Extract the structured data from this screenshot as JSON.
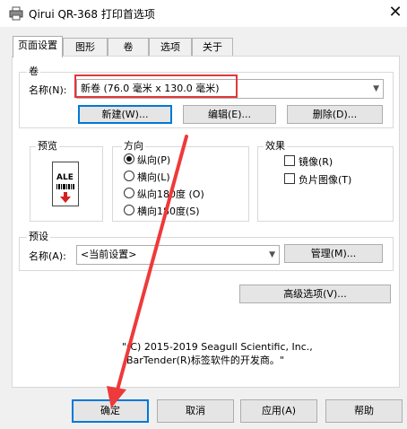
{
  "window": {
    "title": "Qirui QR-368 打印首选项",
    "close": "✕"
  },
  "tabs": [
    "页面设置",
    "图形",
    "卷",
    "选项",
    "关于"
  ],
  "roll": {
    "group_title": "卷",
    "name_label": "名称(N):",
    "name_value": "新卷 (76.0 毫米 x 130.0 毫米)",
    "buttons": [
      "新建(W)...",
      "编辑(E)...",
      "删除(D)..."
    ]
  },
  "preview": {
    "title": "预览",
    "sample": "ALE"
  },
  "orientation": {
    "title": "方向",
    "options": [
      "纵向(P)",
      "横向(L)",
      "纵向180度 (O)",
      "横向180度(S)"
    ],
    "selected_index": 0
  },
  "effects": {
    "title": "效果",
    "options": [
      "镜像(R)",
      "负片图像(T)"
    ]
  },
  "preset": {
    "title": "预设",
    "name_label": "名称(A):",
    "name_value": "<当前设置>",
    "manage_button": "管理(M)..."
  },
  "advanced_button": "高级选项(V)...",
  "copyright": {
    "line1": "\"(C) 2015-2019 Seagull Scientific, Inc.,",
    "line2": "BarTender(R)标签软件的开发商。\""
  },
  "footer_buttons": [
    "确定",
    "取消",
    "应用(A)",
    "帮助"
  ],
  "colors": {
    "highlight_box": "#e0383b",
    "annotation_arrow": "#ee3a3a",
    "primary_border": "#0078d7"
  }
}
